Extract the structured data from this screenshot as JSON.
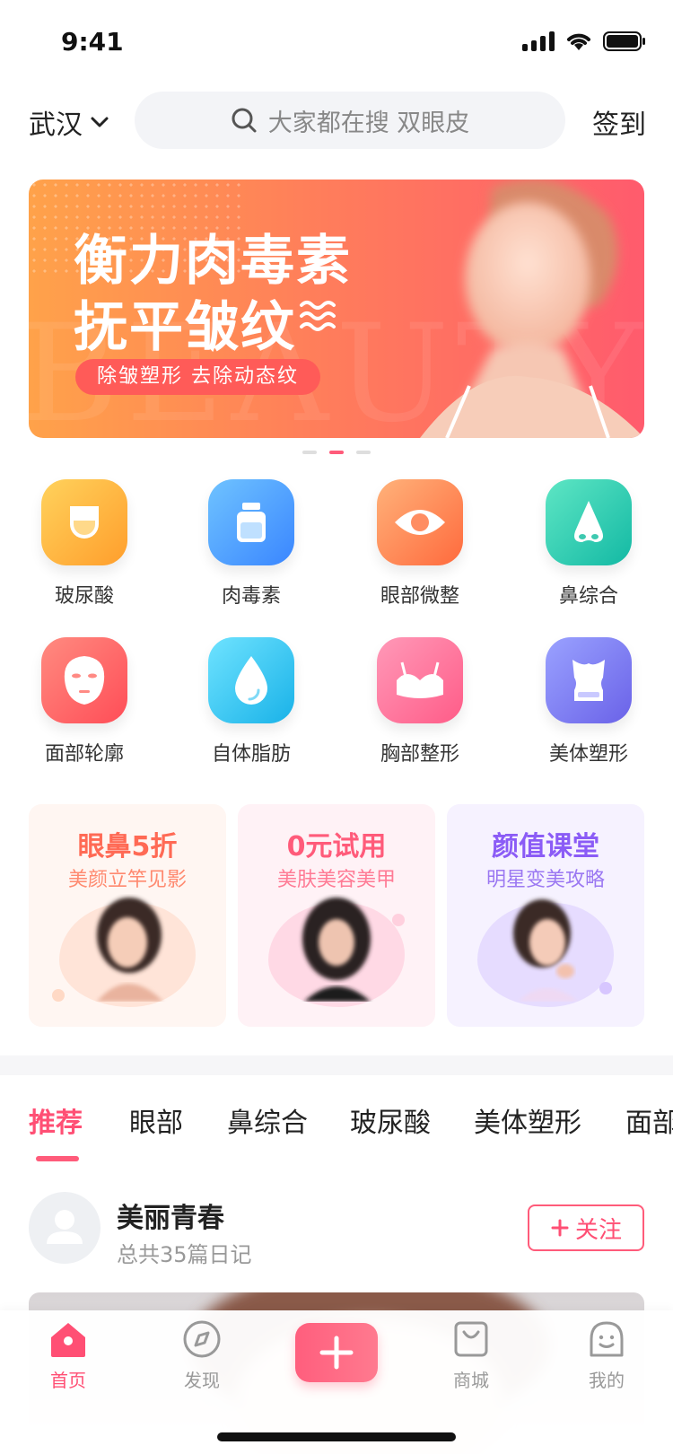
{
  "status": {
    "time": "9:41"
  },
  "header": {
    "city": "武汉",
    "search_placeholder": "大家都在搜 双眼皮",
    "signin": "签到"
  },
  "banner": {
    "title_line1": "衡力肉毒素",
    "title_line2": "抚平皱纹",
    "tagline": "除皱塑形  去除动态纹",
    "background_word": "BEAUTY",
    "gradient": [
      "#ffa24a",
      "#ff5b6d"
    ],
    "pages": 3,
    "active_page": 2
  },
  "categories": [
    {
      "label": "玻尿酸",
      "icon": "hyaluronic-acid-cup-icon",
      "color": "#ffb33f"
    },
    {
      "label": "肉毒素",
      "icon": "botox-bottle-icon",
      "color": "#4aa6ff"
    },
    {
      "label": "眼部微整",
      "icon": "eye-icon",
      "color": "#ff8a4a"
    },
    {
      "label": "鼻综合",
      "icon": "nose-icon",
      "color": "#28d1b6"
    },
    {
      "label": "面部轮廓",
      "icon": "face-mask-icon",
      "color": "#ff5f63"
    },
    {
      "label": "自体脂肪",
      "icon": "fat-drop-icon",
      "color": "#2fc1f0"
    },
    {
      "label": "胸部整形",
      "icon": "bra-icon",
      "color": "#ff6f96"
    },
    {
      "label": "美体塑形",
      "icon": "body-shaping-icon",
      "color": "#7a7cf5"
    }
  ],
  "promos": [
    {
      "title": "眼鼻5折",
      "subtitle": "美颜立竿见影",
      "title_color": "#ff6a55",
      "sub_color": "#ff8a70",
      "bg": "#fff6f2",
      "blob": "#ffe4d8"
    },
    {
      "title": "0元试用",
      "subtitle": "美肤美容美甲",
      "title_color": "#ff5b7a",
      "sub_color": "#ff7b95",
      "bg": "#fff2f6",
      "blob": "#ffd9e5"
    },
    {
      "title": "颜值课堂",
      "subtitle": "明星变美攻略",
      "title_color": "#8b5cf6",
      "sub_color": "#9b78f2",
      "bg": "#f6f2ff",
      "blob": "#e6dcff"
    }
  ],
  "tabs": [
    "推荐",
    "眼部",
    "鼻综合",
    "玻尿酸",
    "美体塑形",
    "面部"
  ],
  "active_tab": 0,
  "diary": {
    "user_name": "美丽青春",
    "diary_count_text": "总共35篇日记",
    "follow_label": "关注"
  },
  "tabbar": [
    {
      "label": "首页",
      "icon": "home-icon",
      "active": true
    },
    {
      "label": "发现",
      "icon": "compass-icon",
      "active": false
    },
    {
      "label": "",
      "icon": "plus-icon",
      "active": false
    },
    {
      "label": "商城",
      "icon": "shopping-bag-icon",
      "active": false
    },
    {
      "label": "我的",
      "icon": "smiley-profile-icon",
      "active": false
    }
  ],
  "colors": {
    "accent": "#ff4f74",
    "text": "#222222",
    "muted": "#999999"
  }
}
